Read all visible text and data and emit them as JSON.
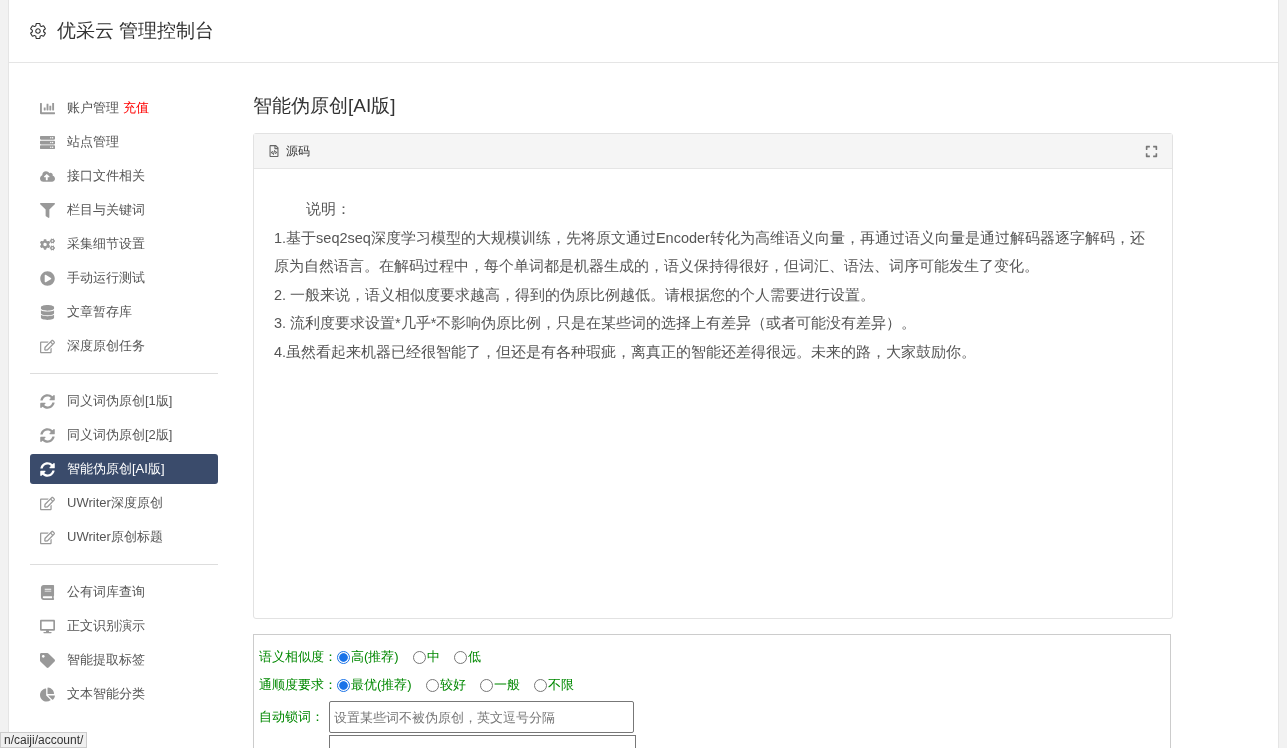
{
  "header": {
    "title": "优采云 管理控制台"
  },
  "sidebar": {
    "groups": [
      {
        "items": [
          {
            "label": "账户管理",
            "badge": "充值",
            "selected": false
          },
          {
            "label": "站点管理",
            "selected": false
          },
          {
            "label": "接口文件相关",
            "selected": false
          },
          {
            "label": "栏目与关键词",
            "selected": false
          },
          {
            "label": "采集细节设置",
            "selected": false
          },
          {
            "label": "手动运行测试",
            "selected": false
          },
          {
            "label": "文章暂存库",
            "selected": false
          },
          {
            "label": "深度原创任务",
            "selected": false
          }
        ]
      },
      {
        "items": [
          {
            "label": "同义词伪原创[1版]",
            "selected": false
          },
          {
            "label": "同义词伪原创[2版]",
            "selected": false
          },
          {
            "label": "智能伪原创[AI版]",
            "selected": true
          },
          {
            "label": "UWriter深度原创",
            "selected": false
          },
          {
            "label": "UWriter原创标题",
            "selected": false
          }
        ]
      },
      {
        "items": [
          {
            "label": "公有词库查询",
            "selected": false
          },
          {
            "label": "正文识别演示",
            "selected": false
          },
          {
            "label": "智能提取标签",
            "selected": false
          },
          {
            "label": "文本智能分类",
            "selected": false
          }
        ]
      }
    ]
  },
  "main": {
    "title": "智能伪原创[AI版]",
    "panel": {
      "title": "源码",
      "lines": [
        "说明：",
        "1.基于seq2seq深度学习模型的大规模训练，先将原文通过Encoder转化为高维语义向量，再通过语义向量是通过解码器逐字解码，还原为自然语言。在解码过程中，每个单词都是机器生成的，语义保持得很好，但词汇、语法、词序可能发生了变化。",
        "2. 一般来说，语义相似度要求越高，得到的伪原比例越低。请根据您的个人需要进行设置。",
        "3. 流利度要求设置*几乎*不影响伪原比例，只是在某些词的选择上有差异（或者可能没有差异）。",
        "4.虽然看起来机器已经很智能了，但还是有各种瑕疵，离真正的智能还差得很远。未来的路，大家鼓励你。"
      ]
    },
    "form": {
      "radio_groups": [
        {
          "label": "语义相似度：",
          "options": [
            {
              "label": "高(推荐)",
              "selected": true
            },
            {
              "label": "中",
              "selected": false
            },
            {
              "label": "低",
              "selected": false
            }
          ]
        },
        {
          "label": "通顺度要求：",
          "options": [
            {
              "label": "最优(推荐)",
              "selected": true
            },
            {
              "label": "较好",
              "selected": false
            },
            {
              "label": "一般",
              "selected": false
            },
            {
              "label": "不限",
              "selected": false
            }
          ]
        }
      ],
      "lock_words": {
        "label": "自动锁词：",
        "placeholder": "设置某些词不被伪原创，英文逗号分隔"
      }
    }
  },
  "status_link": "n/caiji/account/"
}
